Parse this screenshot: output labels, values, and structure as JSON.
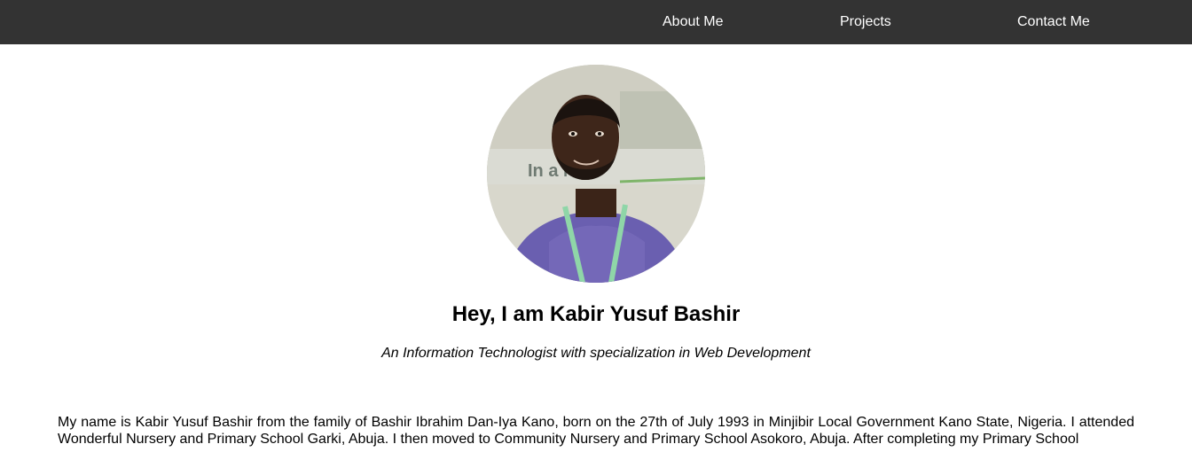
{
  "nav": {
    "items": [
      {
        "label": "About Me"
      },
      {
        "label": "Projects"
      },
      {
        "label": "Contact Me"
      }
    ],
    "background": "#333333",
    "text_color": "#ffffff"
  },
  "profile": {
    "photo_banner_text": "In    a Now",
    "name_heading": "Hey, I am Kabir Yusuf Bashir",
    "tagline": "An Information Technologist with specialization in Web Development",
    "bio": "My name is Kabir Yusuf Bashir from the family of Bashir Ibrahim Dan-Iya Kano, born on the 27th of July 1993 in Minjibir Local Government Kano State, Nigeria. I attended Wonderful Nursery and Primary School Garki, Abuja. I then moved to Community Nursery and Primary School Asokoro, Abuja. After completing my Primary School"
  }
}
